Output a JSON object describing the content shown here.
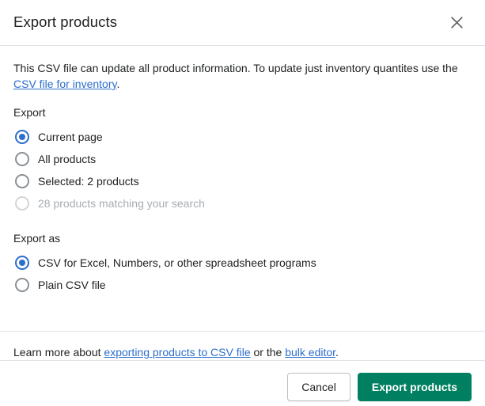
{
  "modal": {
    "title": "Export products",
    "close_icon": "close-icon"
  },
  "description": {
    "before_link": "This CSV file can update all product information. To update just inventory quantites use the ",
    "link_text": "CSV file for inventory",
    "after_link": "."
  },
  "export_section": {
    "label": "Export",
    "options": [
      {
        "label": "Current page",
        "selected": true,
        "disabled": false
      },
      {
        "label": "All products",
        "selected": false,
        "disabled": false
      },
      {
        "label": "Selected: 2 products",
        "selected": false,
        "disabled": false
      },
      {
        "label": "28 products matching your search",
        "selected": false,
        "disabled": true
      }
    ]
  },
  "export_as_section": {
    "label": "Export as",
    "options": [
      {
        "label": "CSV for Excel, Numbers, or other spreadsheet programs",
        "selected": true,
        "disabled": false
      },
      {
        "label": "Plain CSV file",
        "selected": false,
        "disabled": false
      }
    ]
  },
  "learn_more": {
    "prefix": "Learn more about ",
    "link1_text": "exporting products to CSV file",
    "middle": " or the ",
    "link2_text": "bulk editor",
    "suffix": "."
  },
  "footer": {
    "cancel_label": "Cancel",
    "submit_label": "Export products"
  },
  "colors": {
    "primary_green": "#008060",
    "link_blue": "#2c6ecb",
    "radio_selected": "#2c6ecb",
    "border": "#e1e3e5",
    "text": "#202223",
    "text_disabled": "#a7acb1"
  }
}
